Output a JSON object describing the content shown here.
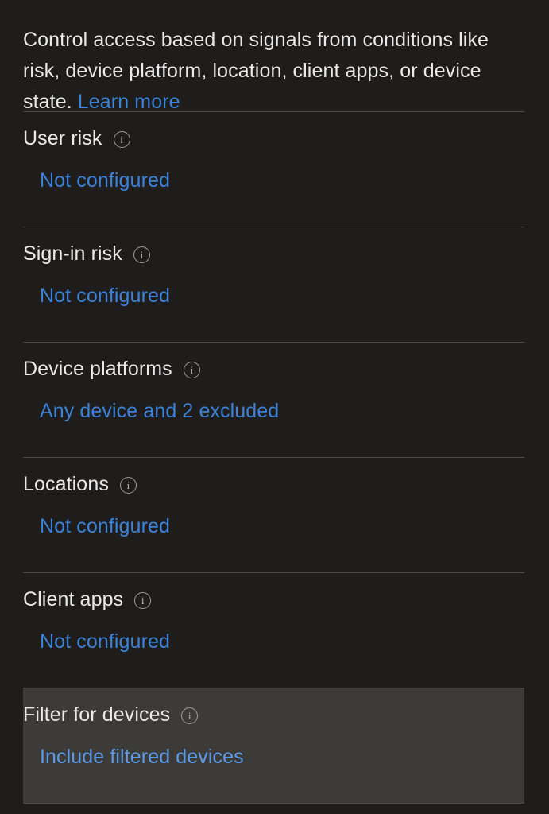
{
  "intro": {
    "text": "Control access based on signals from conditions like risk, device platform, location, client apps, or device state. ",
    "link_label": "Learn more"
  },
  "colors": {
    "background": "#1f1d1b",
    "highlight_background": "#3d3b38",
    "link": "#3b82d8",
    "link_highlight": "#5b9ae8",
    "text": "#e9e9e9",
    "divider": "#4c4a47"
  },
  "sections": [
    {
      "title": "User risk",
      "value": "Not configured",
      "info_icon": "info-icon",
      "highlighted": false
    },
    {
      "title": "Sign-in risk",
      "value": "Not configured",
      "info_icon": "info-icon",
      "highlighted": false
    },
    {
      "title": "Device platforms",
      "value": "Any device and 2 excluded",
      "info_icon": "info-icon",
      "highlighted": false
    },
    {
      "title": "Locations",
      "value": "Not configured",
      "info_icon": "info-icon",
      "highlighted": false
    },
    {
      "title": "Client apps",
      "value": "Not configured",
      "info_icon": "info-icon",
      "highlighted": false
    },
    {
      "title": "Filter for devices",
      "value": "Include filtered devices",
      "info_icon": "info-icon",
      "highlighted": true
    }
  ],
  "info_icon_glyph": "i"
}
